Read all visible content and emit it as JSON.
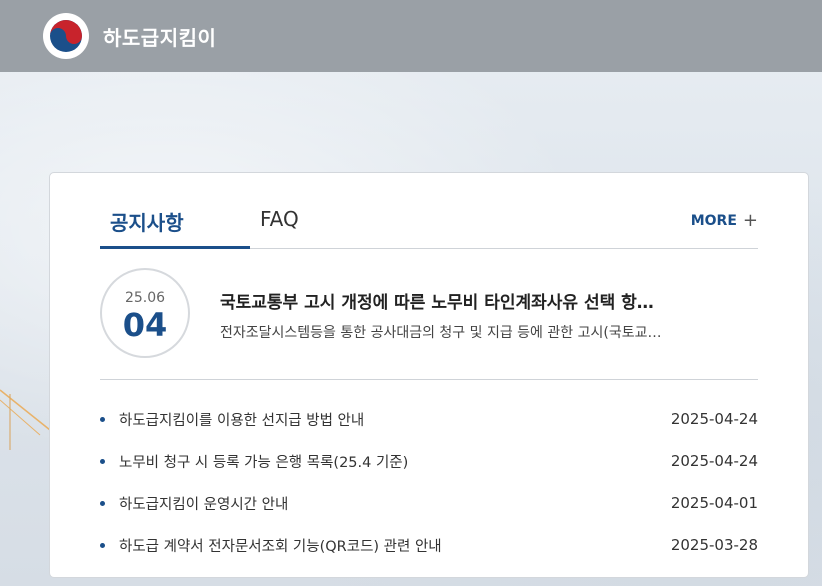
{
  "header": {
    "site_title": "하도급지킴이",
    "logo_icon": "taegeuk-emblem-icon"
  },
  "colors": {
    "accent": "#1b4f8a",
    "header_bg": "#9aa0a6"
  },
  "tabs": [
    {
      "label": "공지사항",
      "active": true
    },
    {
      "label": "FAQ",
      "active": false
    }
  ],
  "more_label": "MORE",
  "featured": {
    "date_ym": "25.06",
    "date_day": "04",
    "title": "국토교통부 고시 개정에 따른 노무비 타인계좌사유 선택 항…",
    "desc": "전자조달시스템등을 통한 공사대금의 청구 및 지급 등에 관한 고시(국토교…"
  },
  "notices": [
    {
      "title": "하도급지킴이를 이용한 선지급 방법 안내",
      "date": "2025-04-24"
    },
    {
      "title": "노무비 청구 시 등록 가능 은행 목록(25.4 기준)",
      "date": "2025-04-24"
    },
    {
      "title": "하도급지킴이 운영시간 안내",
      "date": "2025-04-01"
    },
    {
      "title": "하도급 계약서 전자문서조회 기능(QR코드) 관련 안내",
      "date": "2025-03-28"
    }
  ]
}
